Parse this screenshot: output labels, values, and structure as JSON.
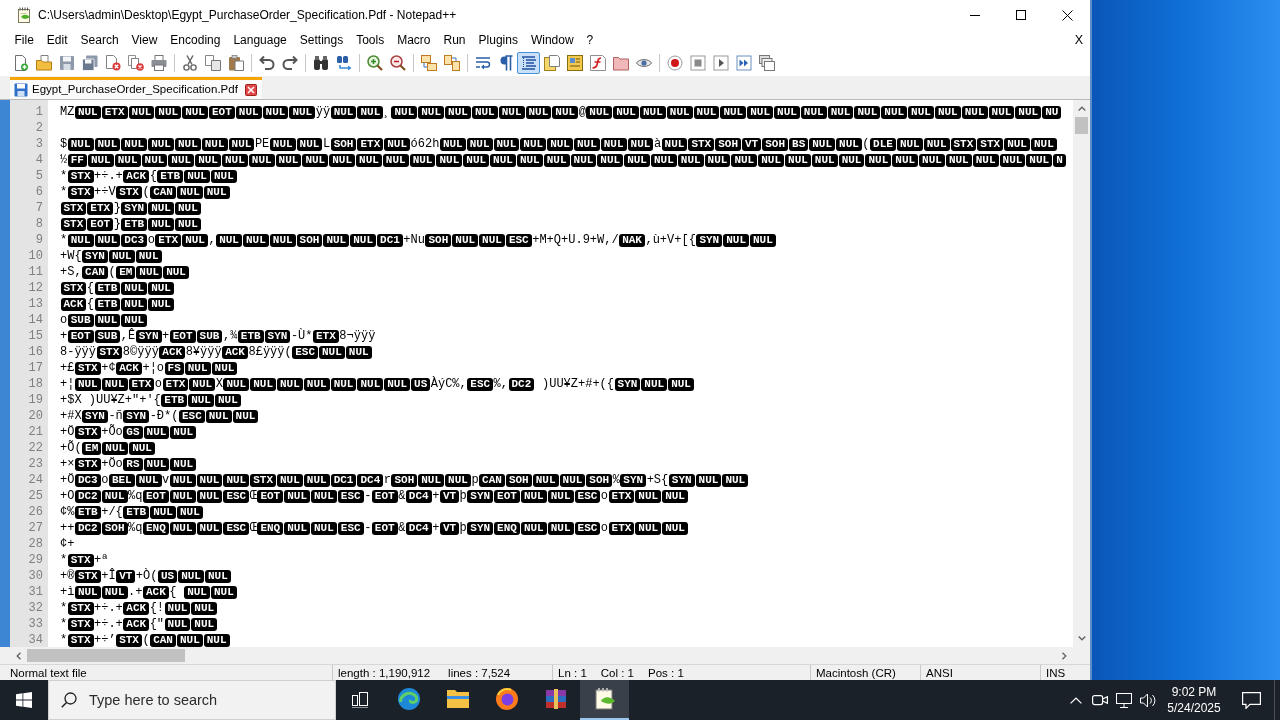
{
  "window": {
    "title": "C:\\Users\\admin\\Desktop\\Egypt_PurchaseOrder_Specification.Pdf - Notepad++"
  },
  "menu": {
    "items": [
      "File",
      "Edit",
      "Search",
      "View",
      "Encoding",
      "Language",
      "Settings",
      "Tools",
      "Macro",
      "Run",
      "Plugins",
      "Window",
      "?"
    ],
    "close": "X"
  },
  "toolbar": [
    [
      {
        "on": false
      },
      {
        "on": false
      },
      {
        "on": false
      },
      {
        "on": false
      },
      {
        "on": false
      },
      {
        "on": false
      },
      {
        "on": false
      }
    ],
    [
      {
        "on": false
      },
      {
        "on": false
      },
      {
        "on": false
      }
    ],
    [
      {
        "on": false
      },
      {
        "on": false
      }
    ],
    [
      {
        "on": false
      },
      {
        "on": false
      }
    ],
    [
      {
        "on": false
      },
      {
        "on": false
      }
    ],
    [
      {
        "on": false
      },
      {
        "on": false
      }
    ],
    [
      {
        "on": false
      },
      {
        "on": false
      },
      {
        "on": true
      },
      {
        "on": false
      },
      {
        "on": false
      },
      {
        "on": false
      },
      {
        "on": false
      },
      {
        "on": false
      }
    ],
    [
      {
        "on": false
      },
      {
        "on": false
      },
      {
        "on": false
      },
      {
        "on": false
      },
      {
        "on": false
      }
    ]
  ],
  "tabs": [
    {
      "label": "Egypt_PurchaseOrder_Specification.Pdf",
      "selected": true
    }
  ],
  "editor": {
    "lines": [
      {
        "number": "1",
        "segments": [
          {
            "kind": "text",
            "text": "MZ"
          },
          {
            "kind": "ctrl",
            "text": "NUL"
          },
          {
            "kind": "ctrl",
            "text": "ETX"
          },
          {
            "kind": "ctrl",
            "text": "NUL"
          },
          {
            "kind": "ctrl",
            "text": "NUL"
          },
          {
            "kind": "ctrl",
            "text": "NUL"
          },
          {
            "kind": "ctrl",
            "text": "EOT"
          },
          {
            "kind": "ctrl",
            "text": "NUL"
          },
          {
            "kind": "ctrl",
            "text": "NUL"
          },
          {
            "kind": "ctrl",
            "text": "NUL"
          },
          {
            "kind": "text",
            "text": "ÿÿ"
          },
          {
            "kind": "ctrl",
            "text": "NUL"
          },
          {
            "kind": "ctrl",
            "text": "NUL"
          },
          {
            "kind": "text",
            "text": "¸"
          },
          {
            "kind": "ctrl",
            "text": "NUL"
          },
          {
            "kind": "ctrl",
            "text": "NUL"
          },
          {
            "kind": "ctrl",
            "text": "NUL"
          },
          {
            "kind": "ctrl",
            "text": "NUL"
          },
          {
            "kind": "ctrl",
            "text": "NUL"
          },
          {
            "kind": "ctrl",
            "text": "NUL"
          },
          {
            "kind": "ctrl",
            "text": "NUL"
          },
          {
            "kind": "text",
            "text": "@"
          },
          {
            "kind": "ctrl",
            "text": "NUL"
          },
          {
            "kind": "ctrl",
            "text": "NUL"
          },
          {
            "kind": "ctrl",
            "text": "NUL"
          },
          {
            "kind": "ctrl",
            "text": "NUL"
          },
          {
            "kind": "ctrl",
            "text": "NUL"
          },
          {
            "kind": "ctrl",
            "text": "NUL"
          },
          {
            "kind": "ctrl",
            "text": "NUL"
          },
          {
            "kind": "ctrl",
            "text": "NUL"
          },
          {
            "kind": "ctrl",
            "text": "NUL"
          },
          {
            "kind": "ctrl",
            "text": "NUL"
          },
          {
            "kind": "ctrl",
            "text": "NUL"
          },
          {
            "kind": "ctrl",
            "text": "NUL"
          },
          {
            "kind": "ctrl",
            "text": "NUL"
          },
          {
            "kind": "ctrl",
            "text": "NUL"
          },
          {
            "kind": "ctrl",
            "text": "NUL"
          },
          {
            "kind": "ctrl",
            "text": "NUL"
          },
          {
            "kind": "ctrl",
            "text": "NUL"
          },
          {
            "kind": "ctrl",
            "text": "NU"
          }
        ]
      },
      {
        "number": "2"
      },
      {
        "number": "3",
        "segments": [
          {
            "kind": "text",
            "text": "$"
          },
          {
            "kind": "ctrl",
            "text": "NUL"
          },
          {
            "kind": "ctrl",
            "text": "NUL"
          },
          {
            "kind": "ctrl",
            "text": "NUL"
          },
          {
            "kind": "ctrl",
            "text": "NUL"
          },
          {
            "kind": "ctrl",
            "text": "NUL"
          },
          {
            "kind": "ctrl",
            "text": "NUL"
          },
          {
            "kind": "ctrl",
            "text": "NUL"
          },
          {
            "kind": "text",
            "text": "PE"
          },
          {
            "kind": "ctrl",
            "text": "NUL"
          },
          {
            "kind": "ctrl",
            "text": "NUL"
          },
          {
            "kind": "text",
            "text": "L"
          },
          {
            "kind": "ctrl",
            "text": "SOH"
          },
          {
            "kind": "ctrl",
            "text": "ETX"
          },
          {
            "kind": "ctrl",
            "text": "NUL"
          },
          {
            "kind": "text",
            "text": "ó62h"
          },
          {
            "kind": "ctrl",
            "text": "NUL"
          },
          {
            "kind": "ctrl",
            "text": "NUL"
          },
          {
            "kind": "ctrl",
            "text": "NUL"
          },
          {
            "kind": "ctrl",
            "text": "NUL"
          },
          {
            "kind": "ctrl",
            "text": "NUL"
          },
          {
            "kind": "ctrl",
            "text": "NUL"
          },
          {
            "kind": "ctrl",
            "text": "NUL"
          },
          {
            "kind": "ctrl",
            "text": "NUL"
          },
          {
            "kind": "text",
            "text": "à"
          },
          {
            "kind": "ctrl",
            "text": "NUL"
          },
          {
            "kind": "ctrl",
            "text": "STX"
          },
          {
            "kind": "ctrl",
            "text": "SOH"
          },
          {
            "kind": "ctrl",
            "text": "VT"
          },
          {
            "kind": "ctrl",
            "text": "SOH"
          },
          {
            "kind": "ctrl",
            "text": "BS"
          },
          {
            "kind": "ctrl",
            "text": "NUL"
          },
          {
            "kind": "ctrl",
            "text": "NUL"
          },
          {
            "kind": "text",
            "text": "("
          },
          {
            "kind": "ctrl",
            "text": "DLE"
          },
          {
            "kind": "ctrl",
            "text": "NUL"
          },
          {
            "kind": "ctrl",
            "text": "NUL"
          },
          {
            "kind": "ctrl",
            "text": "STX"
          },
          {
            "kind": "ctrl",
            "text": "STX"
          },
          {
            "kind": "ctrl",
            "text": "NUL"
          },
          {
            "kind": "ctrl",
            "text": "NUL"
          }
        ]
      },
      {
        "number": "4",
        "segments": [
          {
            "kind": "text",
            "text": "½"
          },
          {
            "kind": "ctrl",
            "text": "FF"
          },
          {
            "kind": "ctrl",
            "text": "NUL"
          },
          {
            "kind": "ctrl",
            "text": "NUL"
          },
          {
            "kind": "ctrl",
            "text": "NUL"
          },
          {
            "kind": "ctrl",
            "text": "NUL"
          },
          {
            "kind": "ctrl",
            "text": "NUL"
          },
          {
            "kind": "ctrl",
            "text": "NUL"
          },
          {
            "kind": "ctrl",
            "text": "NUL"
          },
          {
            "kind": "ctrl",
            "text": "NUL"
          },
          {
            "kind": "ctrl",
            "text": "NUL"
          },
          {
            "kind": "ctrl",
            "text": "NUL"
          },
          {
            "kind": "ctrl",
            "text": "NUL"
          },
          {
            "kind": "ctrl",
            "text": "NUL"
          },
          {
            "kind": "ctrl",
            "text": "NUL"
          },
          {
            "kind": "ctrl",
            "text": "NUL"
          },
          {
            "kind": "ctrl",
            "text": "NUL"
          },
          {
            "kind": "ctrl",
            "text": "NUL"
          },
          {
            "kind": "ctrl",
            "text": "NUL"
          },
          {
            "kind": "ctrl",
            "text": "NUL"
          },
          {
            "kind": "ctrl",
            "text": "NUL"
          },
          {
            "kind": "ctrl",
            "text": "NUL"
          },
          {
            "kind": "ctrl",
            "text": "NUL"
          },
          {
            "kind": "ctrl",
            "text": "NUL"
          },
          {
            "kind": "ctrl",
            "text": "NUL"
          },
          {
            "kind": "ctrl",
            "text": "NUL"
          },
          {
            "kind": "ctrl",
            "text": "NUL"
          },
          {
            "kind": "ctrl",
            "text": "NUL"
          },
          {
            "kind": "ctrl",
            "text": "NUL"
          },
          {
            "kind": "ctrl",
            "text": "NUL"
          },
          {
            "kind": "ctrl",
            "text": "NUL"
          },
          {
            "kind": "ctrl",
            "text": "NUL"
          },
          {
            "kind": "ctrl",
            "text": "NUL"
          },
          {
            "kind": "ctrl",
            "text": "NUL"
          },
          {
            "kind": "ctrl",
            "text": "NUL"
          },
          {
            "kind": "ctrl",
            "text": "NUL"
          },
          {
            "kind": "ctrl",
            "text": "NUL"
          },
          {
            "kind": "ctrl",
            "text": "NUL"
          },
          {
            "kind": "ctrl",
            "text": "N"
          }
        ]
      },
      {
        "number": "5",
        "segments": [
          {
            "kind": "text",
            "text": "*"
          },
          {
            "kind": "ctrl",
            "text": "STX"
          },
          {
            "kind": "text",
            "text": "+÷.+"
          },
          {
            "kind": "ctrl",
            "text": "ACK"
          },
          {
            "kind": "text",
            "text": "{"
          },
          {
            "kind": "ctrl",
            "text": "ETB"
          },
          {
            "kind": "ctrl",
            "text": "NUL"
          },
          {
            "kind": "ctrl",
            "text": "NUL"
          }
        ]
      },
      {
        "number": "6",
        "segments": [
          {
            "kind": "text",
            "text": "*"
          },
          {
            "kind": "ctrl",
            "text": "STX"
          },
          {
            "kind": "text",
            "text": "+÷V"
          },
          {
            "kind": "ctrl",
            "text": "STX"
          },
          {
            "kind": "text",
            "text": "("
          },
          {
            "kind": "ctrl",
            "text": "CAN"
          },
          {
            "kind": "ctrl",
            "text": "NUL"
          },
          {
            "kind": "ctrl",
            "text": "NUL"
          }
        ]
      },
      {
        "number": "7",
        "segments": [
          {
            "kind": "ctrl",
            "text": "STX"
          },
          {
            "kind": "ctrl",
            "text": "ETX"
          },
          {
            "kind": "text",
            "text": "}"
          },
          {
            "kind": "ctrl",
            "text": "SYN"
          },
          {
            "kind": "ctrl",
            "text": "NUL"
          },
          {
            "kind": "ctrl",
            "text": "NUL"
          }
        ]
      },
      {
        "number": "8",
        "segments": [
          {
            "kind": "ctrl",
            "text": "STX"
          },
          {
            "kind": "ctrl",
            "text": "EOT"
          },
          {
            "kind": "text",
            "text": "}"
          },
          {
            "kind": "ctrl",
            "text": "ETB"
          },
          {
            "kind": "ctrl",
            "text": "NUL"
          },
          {
            "kind": "ctrl",
            "text": "NUL"
          }
        ]
      },
      {
        "number": "9",
        "segments": [
          {
            "kind": "text",
            "text": "*"
          },
          {
            "kind": "ctrl",
            "text": "NUL"
          },
          {
            "kind": "ctrl",
            "text": "NUL"
          },
          {
            "kind": "ctrl",
            "text": "DC3"
          },
          {
            "kind": "text",
            "text": "o"
          },
          {
            "kind": "ctrl",
            "text": "ETX"
          },
          {
            "kind": "ctrl",
            "text": "NUL"
          },
          {
            "kind": "text",
            "text": ","
          },
          {
            "kind": "ctrl",
            "text": "NUL"
          },
          {
            "kind": "ctrl",
            "text": "NUL"
          },
          {
            "kind": "ctrl",
            "text": "NUL"
          },
          {
            "kind": "ctrl",
            "text": "SOH"
          },
          {
            "kind": "ctrl",
            "text": "NUL"
          },
          {
            "kind": "ctrl",
            "text": "NUL"
          },
          {
            "kind": "ctrl",
            "text": "DC1"
          },
          {
            "kind": "text",
            "text": "+Nu"
          },
          {
            "kind": "ctrl",
            "text": "SOH"
          },
          {
            "kind": "ctrl",
            "text": "NUL"
          },
          {
            "kind": "ctrl",
            "text": "NUL"
          },
          {
            "kind": "ctrl",
            "text": "ESC"
          },
          {
            "kind": "text",
            "text": "+M+Q+U.9+W,/"
          },
          {
            "kind": "ctrl",
            "text": "NAK"
          },
          {
            "kind": "text",
            "text": ",ù+V+[{"
          },
          {
            "kind": "ctrl",
            "text": "SYN"
          },
          {
            "kind": "ctrl",
            "text": "NUL"
          },
          {
            "kind": "ctrl",
            "text": "NUL"
          }
        ]
      },
      {
        "number": "10",
        "segments": [
          {
            "kind": "text",
            "text": "+W{"
          },
          {
            "kind": "ctrl",
            "text": "SYN"
          },
          {
            "kind": "ctrl",
            "text": "NUL"
          },
          {
            "kind": "ctrl",
            "text": "NUL"
          }
        ]
      },
      {
        "number": "11",
        "segments": [
          {
            "kind": "text",
            "text": "+S,"
          },
          {
            "kind": "ctrl",
            "text": "CAN"
          },
          {
            "kind": "text",
            "text": "("
          },
          {
            "kind": "ctrl",
            "text": "EM"
          },
          {
            "kind": "ctrl",
            "text": "NUL"
          },
          {
            "kind": "ctrl",
            "text": "NUL"
          }
        ]
      },
      {
        "number": "12",
        "segments": [
          {
            "kind": "ctrl",
            "text": "STX"
          },
          {
            "kind": "text",
            "text": "{"
          },
          {
            "kind": "ctrl",
            "text": "ETB"
          },
          {
            "kind": "ctrl",
            "text": "NUL"
          },
          {
            "kind": "ctrl",
            "text": "NUL"
          }
        ]
      },
      {
        "number": "13",
        "segments": [
          {
            "kind": "ctrl",
            "text": "ACK"
          },
          {
            "kind": "text",
            "text": "{"
          },
          {
            "kind": "ctrl",
            "text": "ETB"
          },
          {
            "kind": "ctrl",
            "text": "NUL"
          },
          {
            "kind": "ctrl",
            "text": "NUL"
          }
        ]
      },
      {
        "number": "14",
        "segments": [
          {
            "kind": "text",
            "text": "o"
          },
          {
            "kind": "ctrl",
            "text": "SUB"
          },
          {
            "kind": "ctrl",
            "text": "NUL"
          },
          {
            "kind": "ctrl",
            "text": "NUL"
          }
        ]
      },
      {
        "number": "15",
        "segments": [
          {
            "kind": "text",
            "text": "+"
          },
          {
            "kind": "ctrl",
            "text": "EOT"
          },
          {
            "kind": "ctrl",
            "text": "SUB"
          },
          {
            "kind": "text",
            "text": ",Ê"
          },
          {
            "kind": "ctrl",
            "text": "SYN"
          },
          {
            "kind": "text",
            "text": "+"
          },
          {
            "kind": "ctrl",
            "text": "EOT"
          },
          {
            "kind": "ctrl",
            "text": "SUB"
          },
          {
            "kind": "text",
            "text": ",¾"
          },
          {
            "kind": "ctrl",
            "text": "ETB"
          },
          {
            "kind": "ctrl",
            "text": "SYN"
          },
          {
            "kind": "text",
            "text": "-Ù*"
          },
          {
            "kind": "ctrl",
            "text": "ETX"
          },
          {
            "kind": "text",
            "text": "8¬ÿÿÿ"
          }
        ]
      },
      {
        "number": "16",
        "segments": [
          {
            "kind": "text",
            "text": "8-ÿÿÿ"
          },
          {
            "kind": "ctrl",
            "text": "STX"
          },
          {
            "kind": "text",
            "text": "8©ÿÿÿ"
          },
          {
            "kind": "ctrl",
            "text": "ACK"
          },
          {
            "kind": "text",
            "text": "8¥ÿÿÿ"
          },
          {
            "kind": "ctrl",
            "text": "ACK"
          },
          {
            "kind": "text",
            "text": "8£ÿÿÿ("
          },
          {
            "kind": "ctrl",
            "text": "ESC"
          },
          {
            "kind": "ctrl",
            "text": "NUL"
          },
          {
            "kind": "ctrl",
            "text": "NUL"
          }
        ]
      },
      {
        "number": "17",
        "segments": [
          {
            "kind": "text",
            "text": "+£"
          },
          {
            "kind": "ctrl",
            "text": "STX"
          },
          {
            "kind": "text",
            "text": "+¢"
          },
          {
            "kind": "ctrl",
            "text": "ACK"
          },
          {
            "kind": "text",
            "text": "+¦o"
          },
          {
            "kind": "ctrl",
            "text": "FS"
          },
          {
            "kind": "ctrl",
            "text": "NUL"
          },
          {
            "kind": "ctrl",
            "text": "NUL"
          }
        ]
      },
      {
        "number": "18",
        "segments": [
          {
            "kind": "text",
            "text": "+¦"
          },
          {
            "kind": "ctrl",
            "text": "NUL"
          },
          {
            "kind": "ctrl",
            "text": "NUL"
          },
          {
            "kind": "ctrl",
            "text": "ETX"
          },
          {
            "kind": "text",
            "text": "o"
          },
          {
            "kind": "ctrl",
            "text": "ETX"
          },
          {
            "kind": "ctrl",
            "text": "NUL"
          },
          {
            "kind": "text",
            "text": "X"
          },
          {
            "kind": "ctrl",
            "text": "NUL"
          },
          {
            "kind": "ctrl",
            "text": "NUL"
          },
          {
            "kind": "ctrl",
            "text": "NUL"
          },
          {
            "kind": "ctrl",
            "text": "NUL"
          },
          {
            "kind": "ctrl",
            "text": "NUL"
          },
          {
            "kind": "ctrl",
            "text": "NUL"
          },
          {
            "kind": "ctrl",
            "text": "NUL"
          },
          {
            "kind": "ctrl",
            "text": "US"
          },
          {
            "kind": "text",
            "text": "ÀýC%,"
          },
          {
            "kind": "ctrl",
            "text": "ESC"
          },
          {
            "kind": "text",
            "text": "%,"
          },
          {
            "kind": "ctrl",
            "text": "DC2"
          },
          {
            "kind": "text",
            "text": " )UU¥Z+#+({"
          },
          {
            "kind": "ctrl",
            "text": "SYN"
          },
          {
            "kind": "ctrl",
            "text": "NUL"
          },
          {
            "kind": "ctrl",
            "text": "NUL"
          }
        ]
      },
      {
        "number": "19",
        "segments": [
          {
            "kind": "text",
            "text": "+$X )UU¥Z+\"+'{"
          },
          {
            "kind": "ctrl",
            "text": "ETB"
          },
          {
            "kind": "ctrl",
            "text": "NUL"
          },
          {
            "kind": "ctrl",
            "text": "NUL"
          }
        ]
      },
      {
        "number": "20",
        "segments": [
          {
            "kind": "text",
            "text": "+#X"
          },
          {
            "kind": "ctrl",
            "text": "SYN"
          },
          {
            "kind": "text",
            "text": "-ñ"
          },
          {
            "kind": "ctrl",
            "text": "SYN"
          },
          {
            "kind": "text",
            "text": "-Ð*("
          },
          {
            "kind": "ctrl",
            "text": "ESC"
          },
          {
            "kind": "ctrl",
            "text": "NUL"
          },
          {
            "kind": "ctrl",
            "text": "NUL"
          }
        ]
      },
      {
        "number": "21",
        "segments": [
          {
            "kind": "text",
            "text": "+Ö"
          },
          {
            "kind": "ctrl",
            "text": "STX"
          },
          {
            "kind": "text",
            "text": "+Õo"
          },
          {
            "kind": "ctrl",
            "text": "GS"
          },
          {
            "kind": "ctrl",
            "text": "NUL"
          },
          {
            "kind": "ctrl",
            "text": "NUL"
          }
        ]
      },
      {
        "number": "22",
        "segments": [
          {
            "kind": "text",
            "text": "+Õ("
          },
          {
            "kind": "ctrl",
            "text": "EM"
          },
          {
            "kind": "ctrl",
            "text": "NUL"
          },
          {
            "kind": "ctrl",
            "text": "NUL"
          }
        ]
      },
      {
        "number": "23",
        "segments": [
          {
            "kind": "text",
            "text": "+×"
          },
          {
            "kind": "ctrl",
            "text": "STX"
          },
          {
            "kind": "text",
            "text": "+Öo"
          },
          {
            "kind": "ctrl",
            "text": "RS"
          },
          {
            "kind": "ctrl",
            "text": "NUL"
          },
          {
            "kind": "ctrl",
            "text": "NUL"
          }
        ]
      },
      {
        "number": "24",
        "segments": [
          {
            "kind": "text",
            "text": "+Ö"
          },
          {
            "kind": "ctrl",
            "text": "DC3"
          },
          {
            "kind": "text",
            "text": "o"
          },
          {
            "kind": "ctrl",
            "text": "BEL"
          },
          {
            "kind": "ctrl",
            "text": "NUL"
          },
          {
            "kind": "text",
            "text": "v"
          },
          {
            "kind": "ctrl",
            "text": "NUL"
          },
          {
            "kind": "ctrl",
            "text": "NUL"
          },
          {
            "kind": "ctrl",
            "text": "NUL"
          },
          {
            "kind": "ctrl",
            "text": "STX"
          },
          {
            "kind": "ctrl",
            "text": "NUL"
          },
          {
            "kind": "ctrl",
            "text": "NUL"
          },
          {
            "kind": "ctrl",
            "text": "DC1"
          },
          {
            "kind": "ctrl",
            "text": "DC4"
          },
          {
            "kind": "text",
            "text": "r"
          },
          {
            "kind": "ctrl",
            "text": "SOH"
          },
          {
            "kind": "ctrl",
            "text": "NUL"
          },
          {
            "kind": "ctrl",
            "text": "NUL"
          },
          {
            "kind": "text",
            "text": "p"
          },
          {
            "kind": "ctrl",
            "text": "CAN"
          },
          {
            "kind": "ctrl",
            "text": "SOH"
          },
          {
            "kind": "ctrl",
            "text": "NUL"
          },
          {
            "kind": "ctrl",
            "text": "NUL"
          },
          {
            "kind": "ctrl",
            "text": "SOH"
          },
          {
            "kind": "text",
            "text": "%"
          },
          {
            "kind": "ctrl",
            "text": "SYN"
          },
          {
            "kind": "text",
            "text": "+S{"
          },
          {
            "kind": "ctrl",
            "text": "SYN"
          },
          {
            "kind": "ctrl",
            "text": "NUL"
          },
          {
            "kind": "ctrl",
            "text": "NUL"
          }
        ]
      },
      {
        "number": "25",
        "segments": [
          {
            "kind": "text",
            "text": "+O"
          },
          {
            "kind": "ctrl",
            "text": "DC2"
          },
          {
            "kind": "ctrl",
            "text": "NUL"
          },
          {
            "kind": "text",
            "text": "%q"
          },
          {
            "kind": "ctrl",
            "text": "EOT"
          },
          {
            "kind": "ctrl",
            "text": "NUL"
          },
          {
            "kind": "ctrl",
            "text": "NUL"
          },
          {
            "kind": "ctrl",
            "text": "ESC"
          },
          {
            "kind": "text",
            "text": "Œ"
          },
          {
            "kind": "ctrl",
            "text": "EOT"
          },
          {
            "kind": "ctrl",
            "text": "NUL"
          },
          {
            "kind": "ctrl",
            "text": "NUL"
          },
          {
            "kind": "ctrl",
            "text": "ESC"
          },
          {
            "kind": "text",
            "text": "-"
          },
          {
            "kind": "ctrl",
            "text": "EOT"
          },
          {
            "kind": "text",
            "text": "&"
          },
          {
            "kind": "ctrl",
            "text": "DC4"
          },
          {
            "kind": "text",
            "text": "+"
          },
          {
            "kind": "ctrl",
            "text": "VT"
          },
          {
            "kind": "text",
            "text": "þ"
          },
          {
            "kind": "ctrl",
            "text": "SYN"
          },
          {
            "kind": "ctrl",
            "text": "EOT"
          },
          {
            "kind": "ctrl",
            "text": "NUL"
          },
          {
            "kind": "ctrl",
            "text": "NUL"
          },
          {
            "kind": "ctrl",
            "text": "ESC"
          },
          {
            "kind": "text",
            "text": "o"
          },
          {
            "kind": "ctrl",
            "text": "ETX"
          },
          {
            "kind": "ctrl",
            "text": "NUL"
          },
          {
            "kind": "ctrl",
            "text": "NUL"
          }
        ]
      },
      {
        "number": "26",
        "segments": [
          {
            "kind": "text",
            "text": "¢%"
          },
          {
            "kind": "ctrl",
            "text": "ETB"
          },
          {
            "kind": "text",
            "text": "+/{"
          },
          {
            "kind": "ctrl",
            "text": "ETB"
          },
          {
            "kind": "ctrl",
            "text": "NUL"
          },
          {
            "kind": "ctrl",
            "text": "NUL"
          }
        ]
      },
      {
        "number": "27",
        "segments": [
          {
            "kind": "text",
            "text": "++"
          },
          {
            "kind": "ctrl",
            "text": "DC2"
          },
          {
            "kind": "ctrl",
            "text": "SOH"
          },
          {
            "kind": "text",
            "text": "%q"
          },
          {
            "kind": "ctrl",
            "text": "ENQ"
          },
          {
            "kind": "ctrl",
            "text": "NUL"
          },
          {
            "kind": "ctrl",
            "text": "NUL"
          },
          {
            "kind": "ctrl",
            "text": "ESC"
          },
          {
            "kind": "text",
            "text": "Œ"
          },
          {
            "kind": "ctrl",
            "text": "ENQ"
          },
          {
            "kind": "ctrl",
            "text": "NUL"
          },
          {
            "kind": "ctrl",
            "text": "NUL"
          },
          {
            "kind": "ctrl",
            "text": "ESC"
          },
          {
            "kind": "text",
            "text": "-"
          },
          {
            "kind": "ctrl",
            "text": "EOT"
          },
          {
            "kind": "text",
            "text": "&"
          },
          {
            "kind": "ctrl",
            "text": "DC4"
          },
          {
            "kind": "text",
            "text": "+"
          },
          {
            "kind": "ctrl",
            "text": "VT"
          },
          {
            "kind": "text",
            "text": "þ"
          },
          {
            "kind": "ctrl",
            "text": "SYN"
          },
          {
            "kind": "ctrl",
            "text": "ENQ"
          },
          {
            "kind": "ctrl",
            "text": "NUL"
          },
          {
            "kind": "ctrl",
            "text": "NUL"
          },
          {
            "kind": "ctrl",
            "text": "ESC"
          },
          {
            "kind": "text",
            "text": "o"
          },
          {
            "kind": "ctrl",
            "text": "ETX"
          },
          {
            "kind": "ctrl",
            "text": "NUL"
          },
          {
            "kind": "ctrl",
            "text": "NUL"
          }
        ]
      },
      {
        "number": "28",
        "segments": [
          {
            "kind": "text",
            "text": "¢+"
          }
        ]
      },
      {
        "number": "29",
        "segments": [
          {
            "kind": "text",
            "text": "*"
          },
          {
            "kind": "ctrl",
            "text": "STX"
          },
          {
            "kind": "text",
            "text": "+ª"
          }
        ]
      },
      {
        "number": "30",
        "segments": [
          {
            "kind": "text",
            "text": "+®"
          },
          {
            "kind": "ctrl",
            "text": "STX"
          },
          {
            "kind": "text",
            "text": "+Î"
          },
          {
            "kind": "ctrl",
            "text": "VT"
          },
          {
            "kind": "text",
            "text": "+Ò("
          },
          {
            "kind": "ctrl",
            "text": "US"
          },
          {
            "kind": "ctrl",
            "text": "NUL"
          },
          {
            "kind": "ctrl",
            "text": "NUL"
          }
        ]
      },
      {
        "number": "31",
        "segments": [
          {
            "kind": "text",
            "text": "+ì"
          },
          {
            "kind": "ctrl",
            "text": "NUL"
          },
          {
            "kind": "ctrl",
            "text": "NUL"
          },
          {
            "kind": "text",
            "text": ".+"
          },
          {
            "kind": "ctrl",
            "text": "ACK"
          },
          {
            "kind": "text",
            "text": "{ "
          },
          {
            "kind": "ctrl",
            "text": "NUL"
          },
          {
            "kind": "ctrl",
            "text": "NUL"
          }
        ]
      },
      {
        "number": "32",
        "segments": [
          {
            "kind": "text",
            "text": "*"
          },
          {
            "kind": "ctrl",
            "text": "STX"
          },
          {
            "kind": "text",
            "text": "+÷.+"
          },
          {
            "kind": "ctrl",
            "text": "ACK"
          },
          {
            "kind": "text",
            "text": "{!"
          },
          {
            "kind": "ctrl",
            "text": "NUL"
          },
          {
            "kind": "ctrl",
            "text": "NUL"
          }
        ]
      },
      {
        "number": "33",
        "segments": [
          {
            "kind": "text",
            "text": "*"
          },
          {
            "kind": "ctrl",
            "text": "STX"
          },
          {
            "kind": "text",
            "text": "+÷.+"
          },
          {
            "kind": "ctrl",
            "text": "ACK"
          },
          {
            "kind": "text",
            "text": "{\""
          },
          {
            "kind": "ctrl",
            "text": "NUL"
          },
          {
            "kind": "ctrl",
            "text": "NUL"
          }
        ]
      },
      {
        "number": "34",
        "segments": [
          {
            "kind": "text",
            "text": "*"
          },
          {
            "kind": "ctrl",
            "text": "STX"
          },
          {
            "kind": "text",
            "text": "+÷’"
          },
          {
            "kind": "ctrl",
            "text": "STX"
          },
          {
            "kind": "text",
            "text": "("
          },
          {
            "kind": "ctrl",
            "text": "CAN"
          },
          {
            "kind": "ctrl",
            "text": "NUL"
          },
          {
            "kind": "ctrl",
            "text": "NUL"
          }
        ]
      }
    ]
  },
  "status_bar": [
    [
      "Normal text file"
    ],
    [
      "length : 1,190,912",
      "lines : 7,524"
    ],
    [
      "Ln : 1",
      "Col : 1",
      "Pos : 1"
    ],
    [
      "Macintosh (CR)"
    ],
    [
      "ANSI"
    ],
    [
      "INS"
    ]
  ],
  "taskbar": {
    "search": {
      "placeholder": "Type here to search"
    },
    "apps": [
      {
        "selected": false
      },
      {
        "selected": false
      },
      {
        "selected": false
      },
      {
        "selected": false
      },
      {
        "selected": true
      }
    ],
    "clock": {
      "time": "9:02 PM",
      "date": "5/24/2025"
    }
  }
}
